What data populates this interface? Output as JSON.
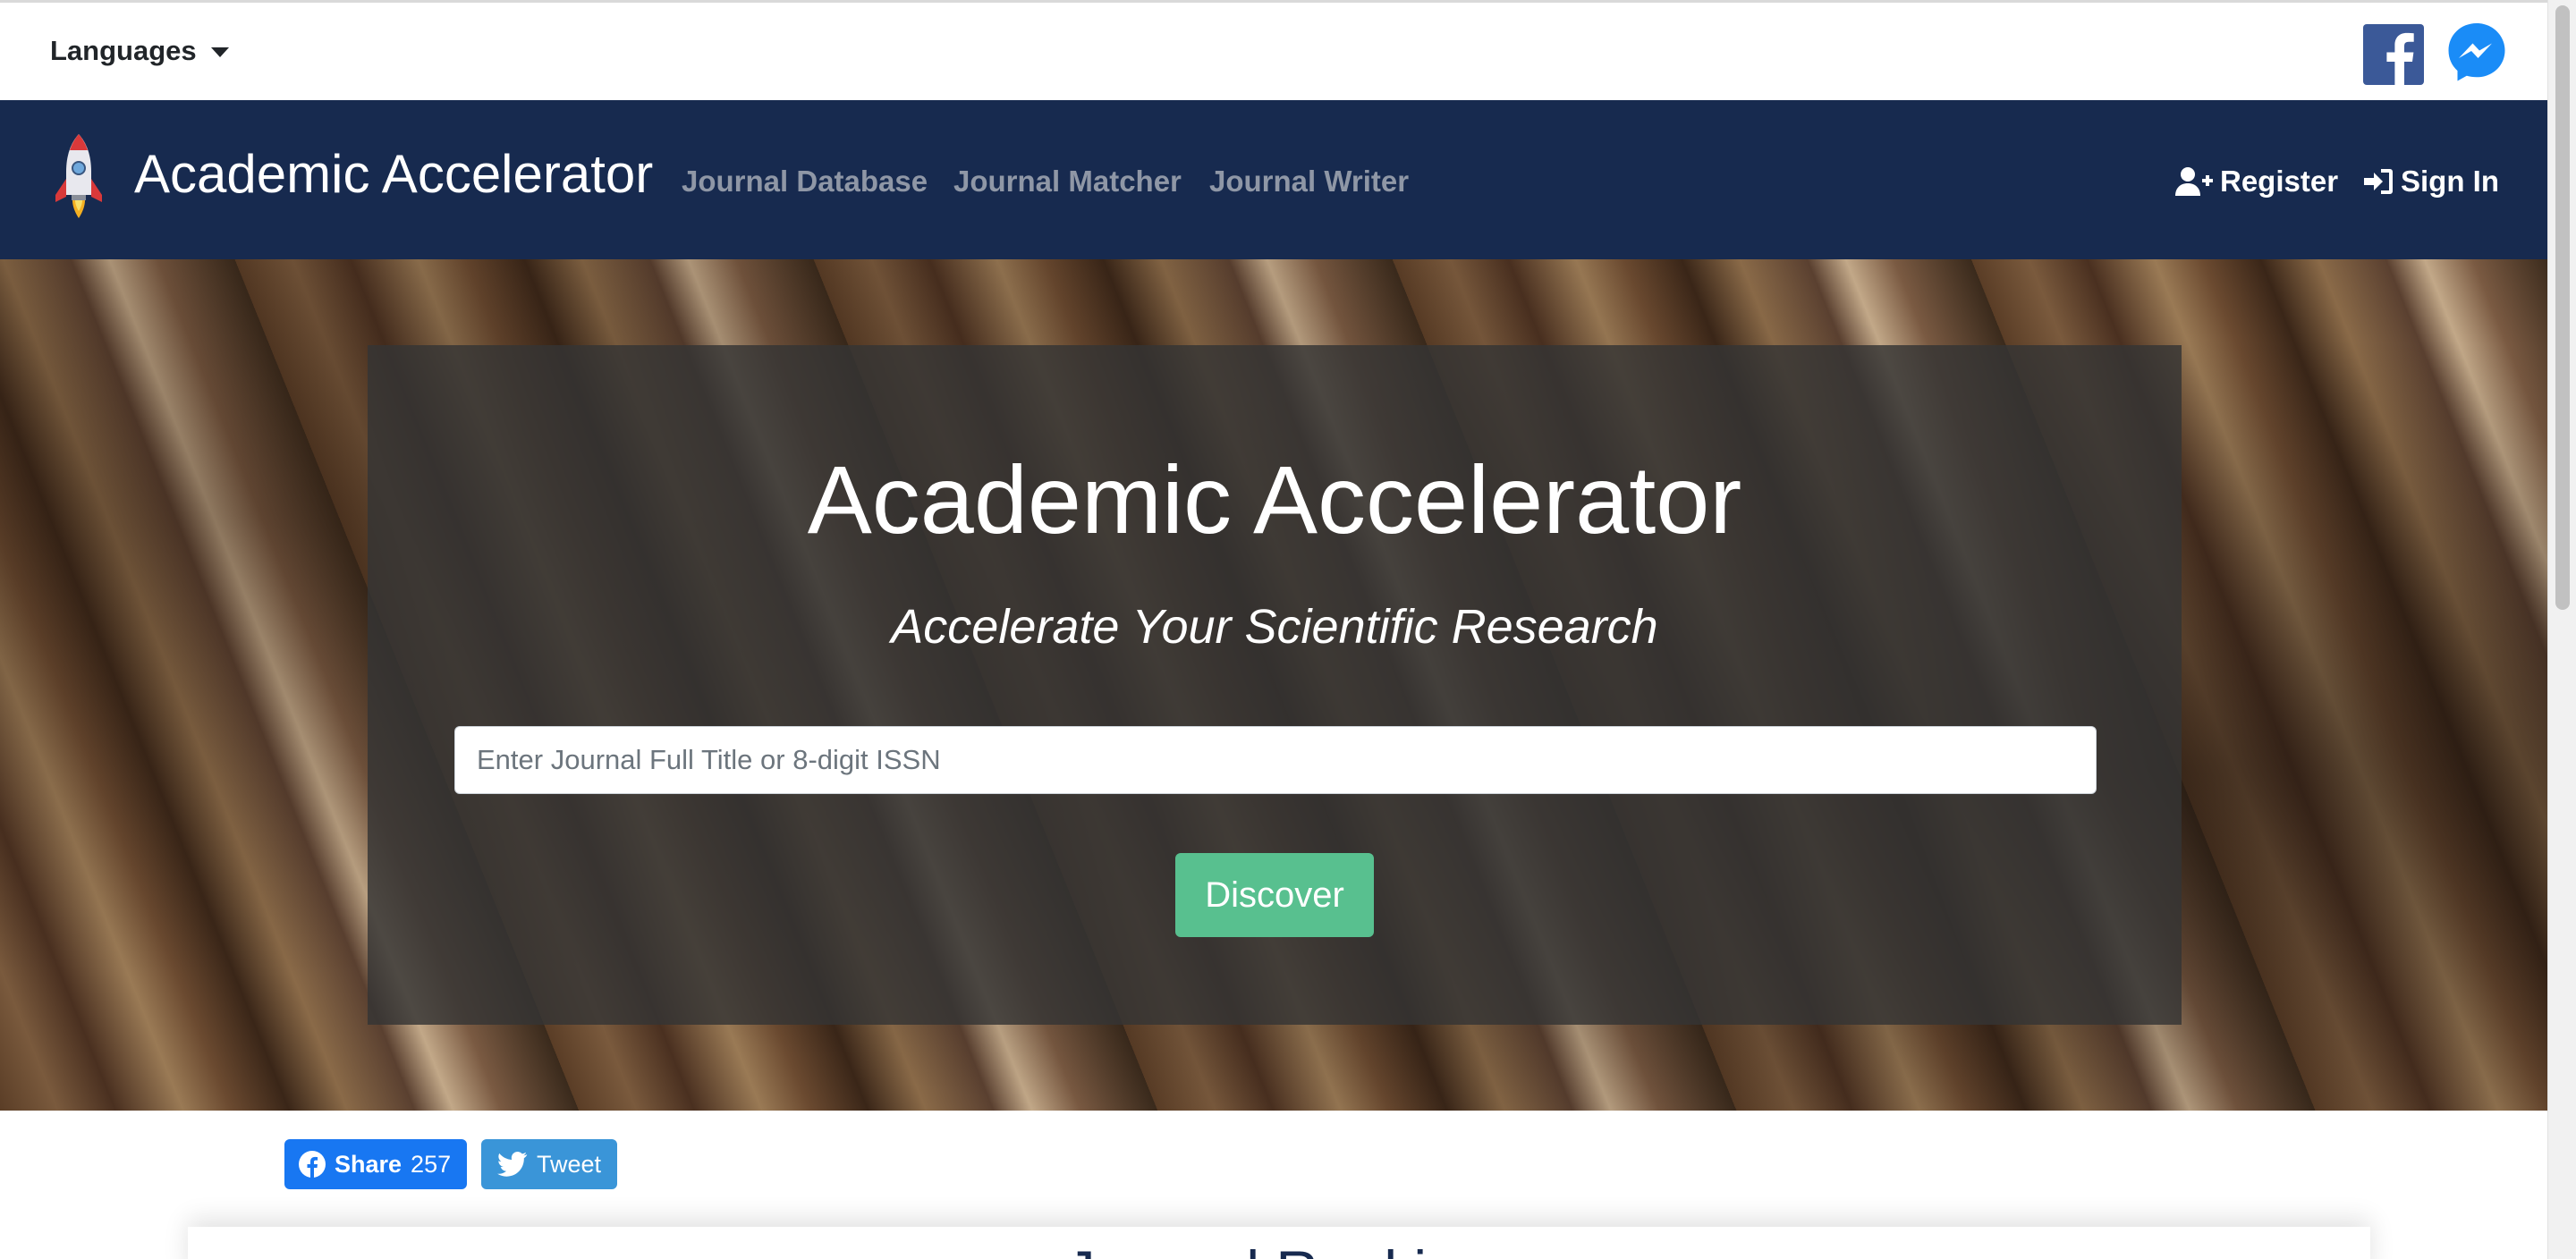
{
  "topbar": {
    "languages_label": "Languages"
  },
  "navbar": {
    "brand": "Academic Accelerator",
    "links": [
      "Journal Database",
      "Journal Matcher",
      "Journal Writer"
    ],
    "register_label": "Register",
    "signin_label": "Sign In"
  },
  "hero": {
    "title": "Academic Accelerator",
    "subtitle": "Accelerate Your Scientific Research",
    "search_placeholder": "Enter Journal Full Title or 8-digit ISSN",
    "discover_label": "Discover"
  },
  "share": {
    "facebook_label": "Share",
    "facebook_count": "257",
    "twitter_label": "Tweet"
  },
  "section": {
    "heading_partial": "Journal Ranking"
  },
  "colors": {
    "navbar_bg": "#172a4f",
    "discover_green": "#58c08f",
    "facebook_blue": "#1877f2",
    "twitter_blue": "#3a95d8"
  },
  "icons": {
    "topbar": [
      "facebook-icon",
      "messenger-icon"
    ],
    "navbar": [
      "rocket-logo-icon",
      "user-plus-icon",
      "sign-in-icon"
    ],
    "share": [
      "facebook-icon",
      "twitter-icon"
    ]
  }
}
